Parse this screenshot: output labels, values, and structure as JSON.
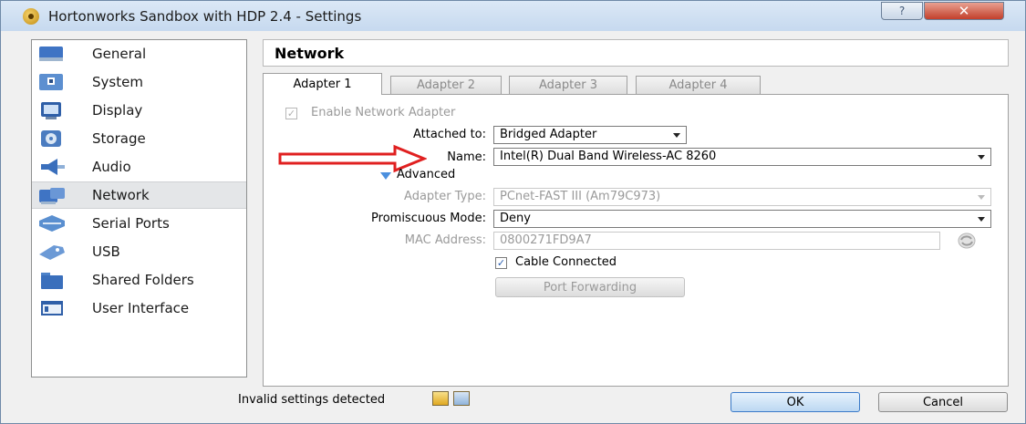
{
  "window": {
    "title": "Hortonworks Sandbox with HDP 2.4 - Settings",
    "help_glyph": "?",
    "close_glyph": "✕"
  },
  "sidebar": {
    "items": [
      {
        "label": "General",
        "icon": "general-icon"
      },
      {
        "label": "System",
        "icon": "system-icon"
      },
      {
        "label": "Display",
        "icon": "display-icon"
      },
      {
        "label": "Storage",
        "icon": "storage-icon"
      },
      {
        "label": "Audio",
        "icon": "audio-icon"
      },
      {
        "label": "Network",
        "icon": "network-icon",
        "active": true
      },
      {
        "label": "Serial Ports",
        "icon": "serial-ports-icon"
      },
      {
        "label": "USB",
        "icon": "usb-icon"
      },
      {
        "label": "Shared Folders",
        "icon": "shared-folders-icon"
      },
      {
        "label": "User Interface",
        "icon": "user-interface-icon"
      }
    ]
  },
  "main": {
    "title": "Network",
    "tabs": [
      "Adapter 1",
      "Adapter 2",
      "Adapter 3",
      "Adapter 4"
    ],
    "active_tab": "Adapter 1",
    "enable_adapter": {
      "label": "Enable Network Adapter",
      "checked": true
    },
    "attached_to": {
      "label": "Attached to:",
      "value": "Bridged Adapter"
    },
    "name": {
      "label": "Name:",
      "value": "Intel(R) Dual Band Wireless-AC 8260"
    },
    "advanced_label": "Advanced",
    "adapter_type": {
      "label": "Adapter Type:",
      "value": "PCnet-FAST III (Am79C973)"
    },
    "promiscuous": {
      "label": "Promiscuous Mode:",
      "value": "Deny"
    },
    "mac": {
      "label": "MAC Address:",
      "value": "0800271FD9A7"
    },
    "cable": {
      "label": "Cable Connected",
      "checked": true
    },
    "port_forwarding_label": "Port Forwarding"
  },
  "footer": {
    "status": "Invalid settings detected",
    "ok_label": "OK",
    "cancel_label": "Cancel"
  },
  "colors": {
    "annotation_arrow": "#e02020",
    "accent": "#3a7ac8"
  }
}
